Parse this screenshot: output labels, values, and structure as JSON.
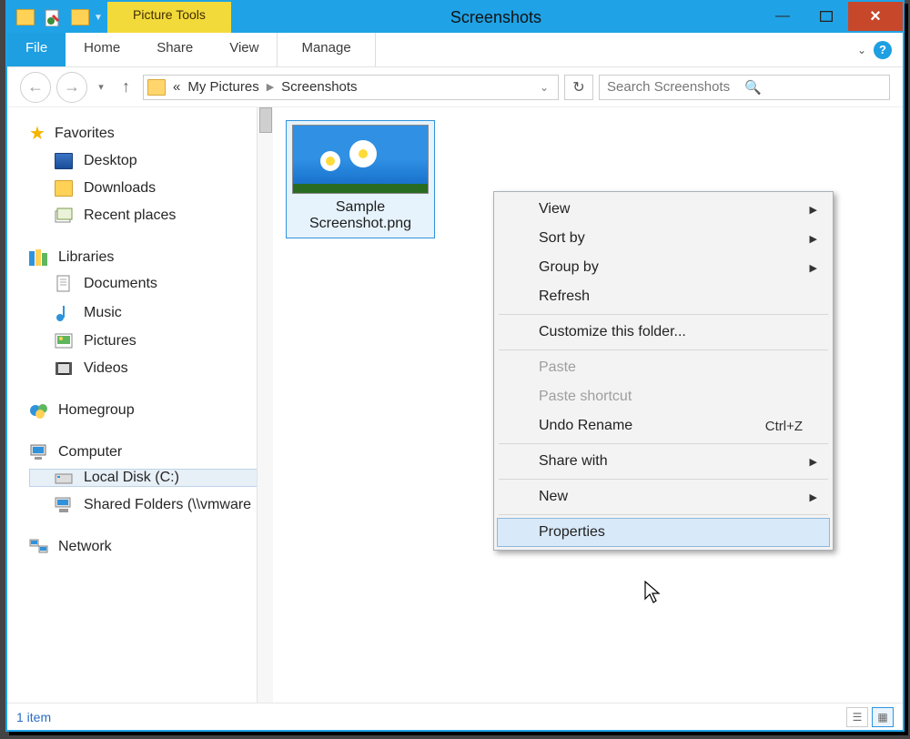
{
  "window": {
    "title": "Screenshots",
    "pictureTools": "Picture Tools"
  },
  "ribbon": {
    "file": "File",
    "tabs": [
      "Home",
      "Share",
      "View"
    ],
    "manage": "Manage"
  },
  "address": {
    "prefix": "«",
    "parts": [
      "My Pictures",
      "Screenshots"
    ]
  },
  "search": {
    "placeholder": "Search Screenshots"
  },
  "sidebar": {
    "favorites": {
      "label": "Favorites",
      "items": [
        "Desktop",
        "Downloads",
        "Recent places"
      ]
    },
    "libraries": {
      "label": "Libraries",
      "items": [
        "Documents",
        "Music",
        "Pictures",
        "Videos"
      ]
    },
    "homegroup": {
      "label": "Homegroup"
    },
    "computer": {
      "label": "Computer",
      "items": [
        "Local Disk (C:)",
        "Shared Folders (\\\\vmware"
      ]
    },
    "network": {
      "label": "Network"
    }
  },
  "file": {
    "name": "Sample Screenshot.png"
  },
  "statusbar": {
    "count": "1 item"
  },
  "contextMenu": {
    "view": "View",
    "sortBy": "Sort by",
    "groupBy": "Group by",
    "refresh": "Refresh",
    "customize": "Customize this folder...",
    "paste": "Paste",
    "pasteShortcut": "Paste shortcut",
    "undoRename": "Undo Rename",
    "undoShortcut": "Ctrl+Z",
    "shareWith": "Share with",
    "new": "New",
    "properties": "Properties"
  }
}
